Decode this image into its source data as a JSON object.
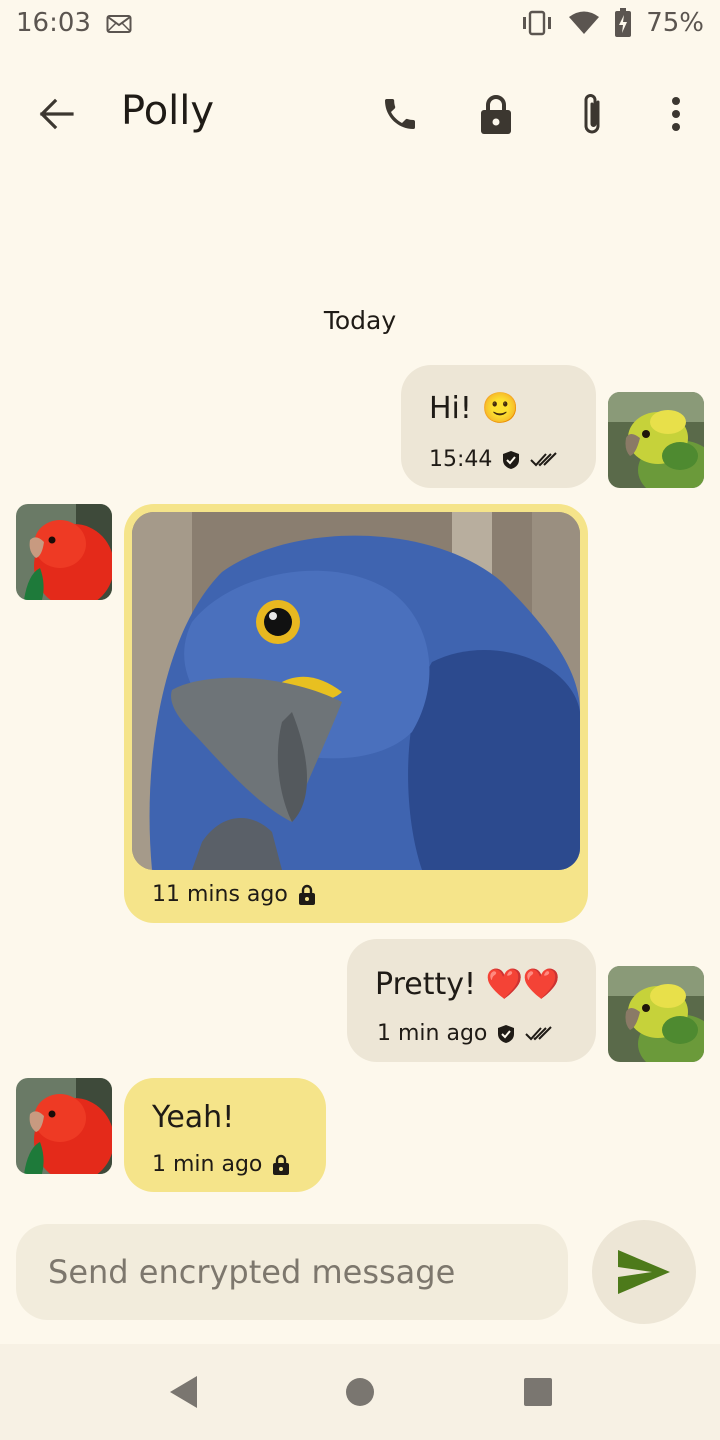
{
  "status_bar": {
    "time": "16:03",
    "battery": "75%",
    "icons": [
      "mail-icon",
      "vibrate-icon",
      "wifi-icon",
      "battery-charging-icon"
    ]
  },
  "app_bar": {
    "title": "Polly",
    "icons": [
      "back-arrow-icon",
      "phone-icon",
      "lock-icon",
      "attachment-icon",
      "more-vert-icon"
    ]
  },
  "conversation": {
    "date_separator": "Today",
    "messages": [
      {
        "direction": "outgoing",
        "text": "Hi! 🙂",
        "time": "15:44",
        "status_icons": [
          "shield-check-icon",
          "double-check-icon"
        ]
      },
      {
        "direction": "incoming",
        "type": "image",
        "image": "blue-parrot-photo",
        "time": "11 mins ago",
        "status_icons": [
          "lock-icon"
        ]
      },
      {
        "direction": "outgoing",
        "text": "Pretty! ❤️❤️",
        "time": "1 min ago",
        "status_icons": [
          "shield-check-icon",
          "double-check-icon"
        ]
      },
      {
        "direction": "incoming",
        "text": "Yeah!",
        "time": "1 min ago",
        "status_icons": [
          "lock-icon"
        ]
      }
    ]
  },
  "composer": {
    "placeholder": "Send encrypted message",
    "value": ""
  },
  "colors": {
    "background": "#fdf8ec",
    "outgoing_bubble": "#ede6d6",
    "incoming_bubble": "#f5e48a",
    "send_icon": "#4d7a1a"
  },
  "nav_bar": {
    "icons": [
      "nav-back-icon",
      "nav-home-icon",
      "nav-recents-icon"
    ]
  }
}
